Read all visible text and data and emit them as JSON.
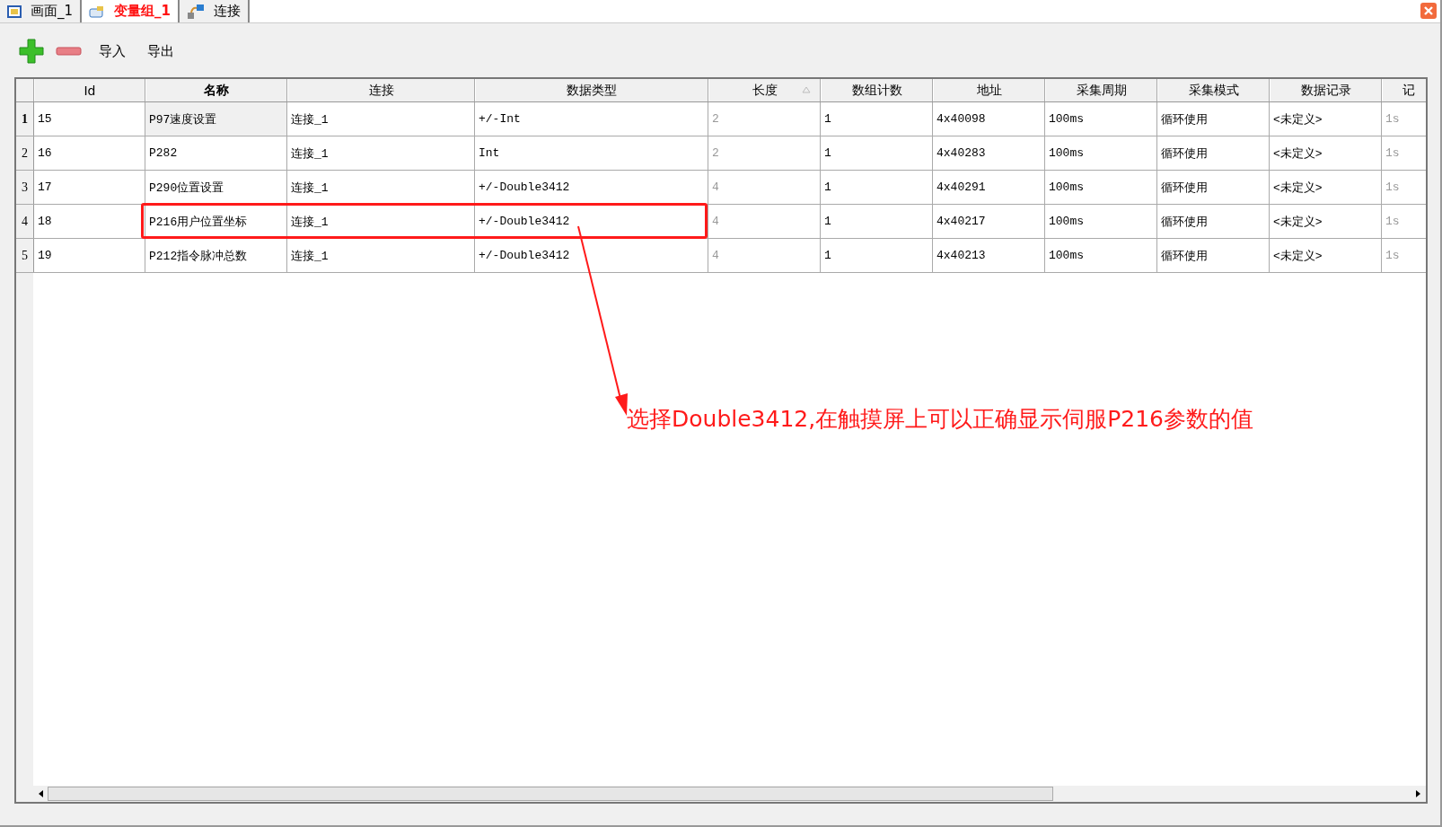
{
  "tabs": [
    {
      "label": "画面_1",
      "selected": false,
      "kind": "screen"
    },
    {
      "label": "变量组_1",
      "selected": true,
      "kind": "group"
    },
    {
      "label": "连接",
      "selected": false,
      "kind": "link"
    }
  ],
  "toolbar": {
    "import": "导入",
    "export": "导出"
  },
  "table": {
    "columns": [
      {
        "label": "Id",
        "bold": false,
        "sorted": false
      },
      {
        "label": "名称",
        "bold": true,
        "sorted": false
      },
      {
        "label": "连接",
        "bold": false,
        "sorted": false
      },
      {
        "label": "数据类型",
        "bold": false,
        "sorted": false
      },
      {
        "label": "长度",
        "bold": false,
        "sorted": true
      },
      {
        "label": "数组计数",
        "bold": false,
        "sorted": false
      },
      {
        "label": "地址",
        "bold": false,
        "sorted": false
      },
      {
        "label": "采集周期",
        "bold": false,
        "sorted": false
      },
      {
        "label": "采集模式",
        "bold": false,
        "sorted": false
      },
      {
        "label": "数据记录",
        "bold": false,
        "sorted": false
      },
      {
        "label": "记",
        "bold": false,
        "sorted": false
      }
    ],
    "rows": [
      {
        "number": "1",
        "current": true,
        "cells": [
          "15",
          "P97速度设置",
          "连接_1",
          "+/-Int",
          "2",
          "1",
          "4x40098",
          "100ms",
          "循环使用",
          "<未定义>",
          "1s"
        ]
      },
      {
        "number": "2",
        "current": false,
        "cells": [
          "16",
          "P282",
          "连接_1",
          "Int",
          "2",
          "1",
          "4x40283",
          "100ms",
          "循环使用",
          "<未定义>",
          "1s"
        ]
      },
      {
        "number": "3",
        "current": false,
        "cells": [
          "17",
          "P290位置设置",
          "连接_1",
          "+/-Double3412",
          "4",
          "1",
          "4x40291",
          "100ms",
          "循环使用",
          "<未定义>",
          "1s"
        ]
      },
      {
        "number": "4",
        "current": false,
        "cells": [
          "18",
          "P216用户位置坐标",
          "连接_1",
          "+/-Double3412",
          "4",
          "1",
          "4x40217",
          "100ms",
          "循环使用",
          "<未定义>",
          "1s"
        ]
      },
      {
        "number": "5",
        "current": false,
        "cells": [
          "19",
          "P212指令脉冲总数",
          "连接_1",
          "+/-Double3412",
          "4",
          "1",
          "4x40213",
          "100ms",
          "循环使用",
          "<未定义>",
          "1s"
        ]
      }
    ]
  },
  "annotation": {
    "text": "选择Double3412,在触摸屏上可以正确显示伺服P216参数的值"
  }
}
